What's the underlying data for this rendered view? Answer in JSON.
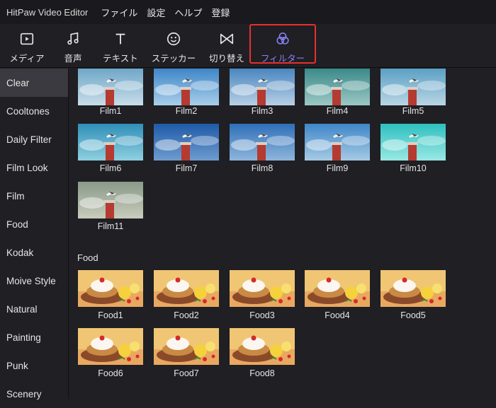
{
  "app_title": "HitPaw Video Editor",
  "menu": [
    "ファイル",
    "設定",
    "ヘルプ",
    "登録"
  ],
  "toolbar": {
    "tools": [
      {
        "id": "media",
        "label": "メディア",
        "icon": "media-icon"
      },
      {
        "id": "audio",
        "label": "音声",
        "icon": "music-note-icon"
      },
      {
        "id": "text",
        "label": "テキスト",
        "icon": "text-t-icon"
      },
      {
        "id": "sticker",
        "label": "ステッカー",
        "icon": "smiley-icon"
      },
      {
        "id": "transition",
        "label": "切り替え",
        "icon": "bowtie-icon"
      },
      {
        "id": "filter",
        "label": "フィルター",
        "icon": "filter-circles-icon",
        "active": true
      }
    ],
    "accent_color": "#8a82f0",
    "highlight_color": "#e8302e"
  },
  "sidebar": {
    "items": [
      "Clear",
      "Cooltones",
      "Daily Filter",
      "Film Look",
      "Film",
      "Food",
      "Kodak",
      "Moive Style",
      "Natural",
      "Painting",
      "Punk",
      "Scenery"
    ],
    "active": "Clear"
  },
  "film_section": {
    "items": [
      "Film1",
      "Film2",
      "Film3",
      "Film4",
      "Film5",
      "Film6",
      "Film7",
      "Film8",
      "Film9",
      "Film10",
      "Film11"
    ]
  },
  "food_section": {
    "title": "Food",
    "items": [
      "Food1",
      "Food2",
      "Food3",
      "Food4",
      "Food5",
      "Food6",
      "Food7",
      "Food8"
    ]
  }
}
